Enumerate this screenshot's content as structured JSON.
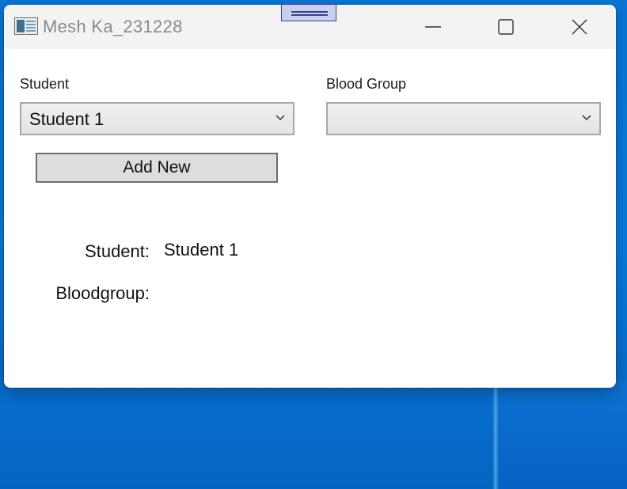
{
  "window": {
    "title": "Mesh Ka_231228",
    "controls": {
      "minimize": "minimize-icon",
      "maximize": "maximize-icon",
      "close": "close-icon"
    }
  },
  "form": {
    "student_label": "Student",
    "student_selected": "Student 1",
    "blood_group_label": "Blood Group",
    "blood_group_selected": "",
    "add_new_label": "Add New"
  },
  "details": {
    "student_label": "Student:",
    "student_value": "Student 1",
    "bloodgroup_label": "Bloodgroup:",
    "bloodgroup_value": ""
  },
  "colors": {
    "desktop": "#0a76d8",
    "titlebar": "#f3f3f3",
    "title_text": "#8a8a8a",
    "grip_fill": "#c7d0f0",
    "grip_border": "#3a3f8a"
  }
}
